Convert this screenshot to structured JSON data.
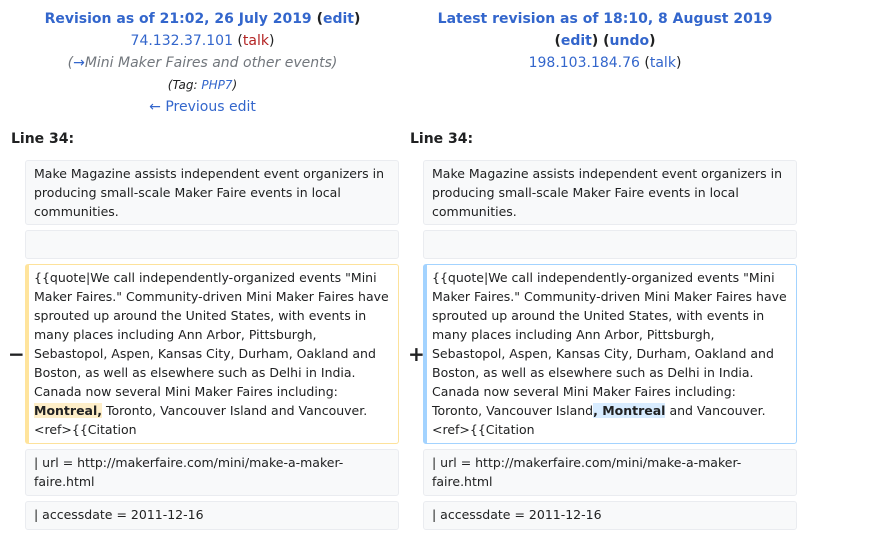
{
  "left": {
    "title_text": "Revision as of 21:02, 26 July 2019",
    "title_edit": "edit",
    "user": "74.132.37.101",
    "user_talk": "talk",
    "comment_arrow": "→",
    "comment_text": "Mini Maker Faires and other events",
    "tag_label": "Tag:",
    "tag_name": "PHP7",
    "prev_edit": "← Previous edit",
    "line_no": "Line 34:",
    "marker": "−",
    "blocks": {
      "b1": "Make Magazine assists independent event organizers in producing small-scale Maker Faire events in local communities.",
      "b3_before": "{{quote|We call independently-organized events \"Mini Maker Faires.\" Community-driven Mini Maker Faires have sprouted up around the United States, with events in many places including Ann Arbor, Pittsburgh, Sebastopol, Aspen, Kansas City, Durham, Oakland and Boston, as well as elsewhere such as Delhi in India. Canada now several Mini Maker Faires including:",
      "b3_highlight": "Montreal,",
      "b3_after": " Toronto, Vancouver Island and Vancouver.<ref>{{Citation",
      "b4": " | url = http://makerfaire.com/mini/make-a-maker-faire.html",
      "b5": " | accessdate = 2011-12-16"
    }
  },
  "right": {
    "title_text": "Latest revision as of 18:10, 8 August 2019",
    "title_edit": "edit",
    "title_undo": "undo",
    "user": "198.103.184.76",
    "user_talk": "talk",
    "line_no": "Line 34:",
    "marker": "+",
    "blocks": {
      "b1": "Make Magazine assists independent event organizers in producing small-scale Maker Faire events in local communities.",
      "b3_before": "{{quote|We call independently-organized events \"Mini Maker Faires.\" Community-driven Mini Maker Faires have sprouted up around the United States, with events in many places including Ann Arbor, Pittsburgh, Sebastopol, Aspen, Kansas City, Durham, Oakland and Boston, as well as elsewhere such as Delhi in India. Canada now several Mini Maker Faires including: Toronto, Vancouver Island",
      "b3_highlight": ", Montreal",
      "b3_after": " and Vancouver.<ref>{{Citation",
      "b4": " | url = http://makerfaire.com/mini/make-a-maker-faire.html",
      "b5": " | accessdate = 2011-12-16"
    }
  }
}
